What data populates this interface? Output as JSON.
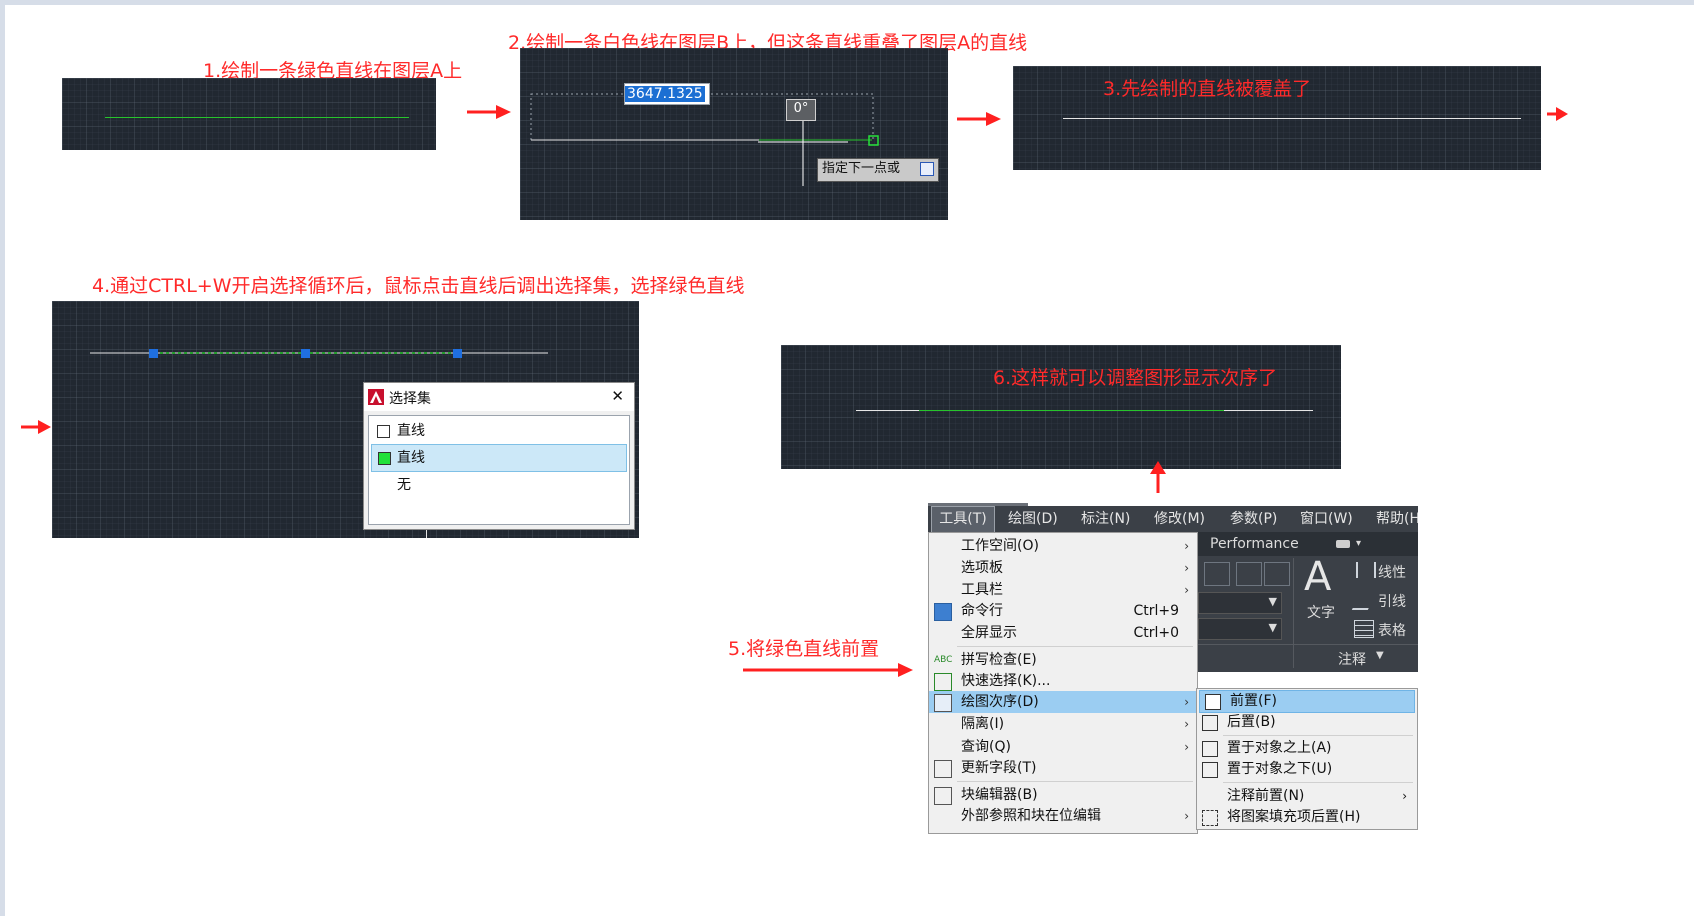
{
  "captions": {
    "step1": "1.绘制一条绿色直线在图层A上",
    "step2": "2.绘制一条白色线在图层B上，但这条直线重叠了图层A的直线",
    "step3": "3.先绘制的直线被覆盖了",
    "step4": "4.通过CTRL+W开启选择循环后，鼠标点击直线后调出选择集，选择绿色直线",
    "step5": "5.将绿色直线前置",
    "step6": "6.这样就可以调整图形显示次序了"
  },
  "panel2": {
    "length_input": "3647.1325",
    "angle_value": "0°",
    "prompt_tooltip": "指定下一点或"
  },
  "selection_dialog": {
    "title": "选择集",
    "close_glyph": "✕",
    "items": [
      {
        "label": "直线",
        "color": "#ffffff",
        "selected": false
      },
      {
        "label": "直线",
        "color": "#21e13a",
        "selected": true
      },
      {
        "label": "无",
        "color": null,
        "selected": false
      }
    ]
  },
  "menubar": {
    "items": [
      "工具(T)",
      "绘图(D)",
      "标注(N)",
      "修改(M)",
      "参数(P)",
      "窗口(W)",
      "帮助(H"
    ]
  },
  "tools_menu": {
    "items": [
      {
        "label": "工作空间(O)",
        "submenu": true
      },
      {
        "label": "选项板",
        "submenu": true
      },
      {
        "label": "工具栏",
        "submenu": true
      },
      {
        "label": "命令行",
        "shortcut": "Ctrl+9"
      },
      {
        "label": "全屏显示",
        "shortcut": "Ctrl+0"
      },
      {
        "label": "拼写检查(E)"
      },
      {
        "label": "快速选择(K)..."
      },
      {
        "label": "绘图次序(D)",
        "submenu": true,
        "highlighted": true
      },
      {
        "label": "隔离(I)",
        "submenu": true
      },
      {
        "label": "查询(Q)",
        "submenu": true
      },
      {
        "label": "更新字段(T)"
      },
      {
        "label": "块编辑器(B)"
      },
      {
        "label": "外部参照和块在位编辑",
        "submenu": true
      }
    ]
  },
  "draw_order_submenu": {
    "items": [
      {
        "label": "前置(F)",
        "highlighted": true
      },
      {
        "label": "后置(B)"
      },
      {
        "label": "置于对象之上(A)"
      },
      {
        "label": "置于对象之下(U)"
      },
      {
        "label": "注释前置(N)",
        "submenu": true
      },
      {
        "label": "将图案填充项后置(H)"
      }
    ]
  },
  "ribbon": {
    "workspace": "Performance",
    "text_button": "文字",
    "linear": "线性",
    "leader": "引线",
    "table": "表格",
    "annotation_panel": "注释"
  },
  "colors": {
    "caption_red": "#ff2a2a",
    "cad_background": "#212831",
    "green_line": "#27c42c",
    "grip_blue": "#1f6fe0",
    "menu_highlight": "#9bcdf2"
  }
}
